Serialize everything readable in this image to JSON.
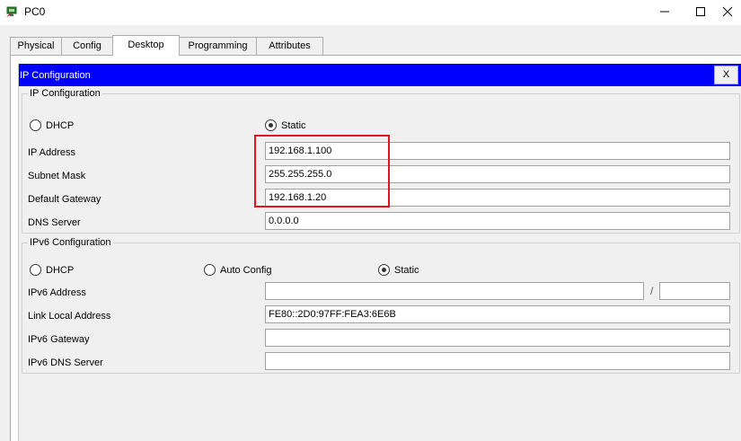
{
  "window": {
    "title": "PC0",
    "icon": "pc-app-icon",
    "controls": [
      "minimize-icon",
      "maximize-icon",
      "close-icon"
    ]
  },
  "tabs": [
    {
      "label": "Physical"
    },
    {
      "label": "Config"
    },
    {
      "label": "Desktop",
      "active": true
    },
    {
      "label": "Programming"
    },
    {
      "label": "Attributes"
    }
  ],
  "panel": {
    "title": "IP Configuration",
    "close_label": "X",
    "header_color": "#0000ff"
  },
  "ipv4": {
    "legend": "IP Configuration",
    "dhcp_label": "DHCP",
    "static_label": "Static",
    "selected": "Static",
    "ip_address_label": "IP Address",
    "ip_address": "192.168.1.100",
    "subnet_mask_label": "Subnet Mask",
    "subnet_mask": "255.255.255.0",
    "gateway_label": "Default Gateway",
    "gateway": "192.168.1.20",
    "dns_label": "DNS Server",
    "dns": "0.0.0.0"
  },
  "ipv6": {
    "legend": "IPv6 Configuration",
    "dhcp_label": "DHCP",
    "auto_label": "Auto Config",
    "static_label": "Static",
    "selected": "Static",
    "address_label": "IPv6 Address",
    "address": "",
    "prefix_separator": "/",
    "prefix": "",
    "link_local_label": "Link Local Address",
    "link_local": "FE80::2D0:97FF:FEA3:6E6B",
    "gateway_label": "IPv6 Gateway",
    "gateway": "",
    "dns_label": "IPv6 DNS Server",
    "dns": ""
  },
  "annotation": {
    "highlight_color": "#e0141e"
  }
}
